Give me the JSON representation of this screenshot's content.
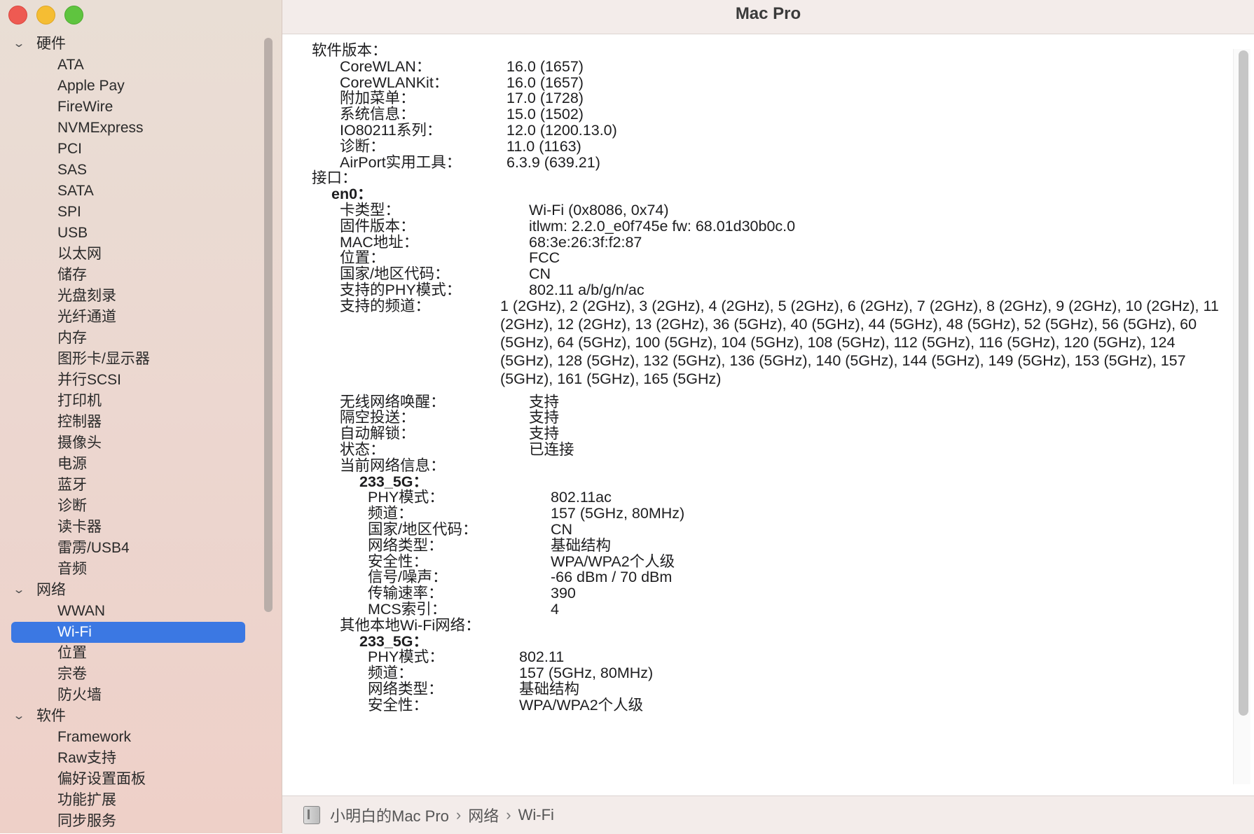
{
  "window": {
    "title": "Mac Pro"
  },
  "sidebar": {
    "groups": [
      {
        "label": "硬件",
        "items": [
          "ATA",
          "Apple Pay",
          "FireWire",
          "NVMExpress",
          "PCI",
          "SAS",
          "SATA",
          "SPI",
          "USB",
          "以太网",
          "储存",
          "光盘刻录",
          "光纤通道",
          "内存",
          "图形卡/显示器",
          "并行SCSI",
          "打印机",
          "控制器",
          "摄像头",
          "电源",
          "蓝牙",
          "诊断",
          "读卡器",
          "雷雳/USB4",
          "音频"
        ]
      },
      {
        "label": "网络",
        "items": [
          "WWAN",
          "Wi-Fi",
          "位置",
          "宗卷",
          "防火墙"
        ]
      },
      {
        "label": "软件",
        "items": [
          "Framework",
          "Raw支持",
          "偏好设置面板",
          "功能扩展",
          "同步服务"
        ]
      }
    ],
    "selected": "Wi-Fi"
  },
  "content": {
    "software_heading": "软件版本：",
    "software": [
      {
        "k": "CoreWLAN：",
        "v": "16.0 (1657)"
      },
      {
        "k": "CoreWLANKit：",
        "v": "16.0 (1657)"
      },
      {
        "k": "附加菜单：",
        "v": "17.0 (1728)"
      },
      {
        "k": "系统信息：",
        "v": "15.0 (1502)"
      },
      {
        "k": "IO80211系列：",
        "v": "12.0 (1200.13.0)"
      },
      {
        "k": "诊断：",
        "v": "11.0 (1163)"
      },
      {
        "k": "AirPort实用工具：",
        "v": "6.3.9 (639.21)"
      }
    ],
    "interface_heading": "接口：",
    "iface_name": "en0：",
    "iface": [
      {
        "k": "卡类型：",
        "v": "Wi-Fi  (0x8086, 0x74)"
      },
      {
        "k": "固件版本：",
        "v": "itlwm: 2.2.0_e0f745e fw: 68.01d30b0c.0"
      },
      {
        "k": "MAC地址：",
        "v": "68:3e:26:3f:f2:87"
      },
      {
        "k": "位置：",
        "v": "FCC"
      },
      {
        "k": "国家/地区代码：",
        "v": "CN"
      },
      {
        "k": "支持的PHY模式：",
        "v": "802.11 a/b/g/n/ac"
      }
    ],
    "channels_label": "支持的频道：",
    "channels_value": "1 (2GHz), 2 (2GHz), 3 (2GHz), 4 (2GHz), 5 (2GHz), 6 (2GHz), 7 (2GHz), 8 (2GHz), 9 (2GHz), 10 (2GHz), 11 (2GHz), 12 (2GHz), 13 (2GHz), 36 (5GHz), 40 (5GHz), 44 (5GHz), 48 (5GHz), 52 (5GHz), 56 (5GHz), 60 (5GHz), 64 (5GHz), 100 (5GHz), 104 (5GHz), 108 (5GHz), 112 (5GHz), 116 (5GHz), 120 (5GHz), 124 (5GHz), 128 (5GHz), 132 (5GHz), 136 (5GHz), 140 (5GHz), 144 (5GHz), 149 (5GHz), 153 (5GHz), 157 (5GHz), 161 (5GHz), 165 (5GHz)",
    "iface2": [
      {
        "k": "无线网络唤醒：",
        "v": "支持"
      },
      {
        "k": "隔空投送：",
        "v": "支持"
      },
      {
        "k": "自动解锁：",
        "v": "支持"
      },
      {
        "k": "状态：",
        "v": "已连接"
      }
    ],
    "current_heading": "当前网络信息：",
    "current_ssid": "233_5G：",
    "current": [
      {
        "k": "PHY模式：",
        "v": "802.11ac"
      },
      {
        "k": "频道：",
        "v": "157 (5GHz, 80MHz)"
      },
      {
        "k": "国家/地区代码：",
        "v": "CN"
      },
      {
        "k": "网络类型：",
        "v": "基础结构"
      },
      {
        "k": "安全性：",
        "v": "WPA/WPA2个人级"
      },
      {
        "k": "信号/噪声：",
        "v": "-66 dBm / 70 dBm"
      },
      {
        "k": "传输速率：",
        "v": "390"
      },
      {
        "k": "MCS索引：",
        "v": "4"
      }
    ],
    "other_heading": "其他本地Wi-Fi网络：",
    "other_ssid": "233_5G：",
    "other": [
      {
        "k": "PHY模式：",
        "v": "802.11"
      },
      {
        "k": "频道：",
        "v": "157 (5GHz, 80MHz)"
      },
      {
        "k": "网络类型：",
        "v": "基础结构"
      },
      {
        "k": "安全性：",
        "v": "WPA/WPA2个人级"
      }
    ]
  },
  "statusbar": {
    "path": [
      "小明白的Mac Pro",
      "网络",
      "Wi-Fi"
    ],
    "separator": "›"
  }
}
